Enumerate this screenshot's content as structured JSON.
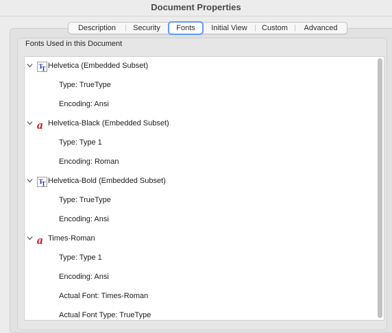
{
  "window": {
    "title": "Document Properties"
  },
  "tabs": [
    {
      "label": "Description",
      "active": false
    },
    {
      "label": "Security",
      "active": false
    },
    {
      "label": "Fonts",
      "active": true
    },
    {
      "label": "Initial View",
      "active": false
    },
    {
      "label": "Custom",
      "active": false
    },
    {
      "label": "Advanced",
      "active": false
    }
  ],
  "fonts_panel": {
    "group_label": "Fonts Used in this Document",
    "fonts": [
      {
        "name": "Helvetica (Embedded Subset)",
        "icon": "truetype-font-icon",
        "expanded": true,
        "details": [
          "Type: TrueType",
          "Encoding: Ansi"
        ]
      },
      {
        "name": "Helvetica-Black (Embedded Subset)",
        "icon": "type1-font-icon",
        "expanded": true,
        "details": [
          "Type: Type 1",
          "Encoding: Roman"
        ]
      },
      {
        "name": "Helvetica-Bold (Embedded Subset)",
        "icon": "truetype-font-icon",
        "expanded": true,
        "details": [
          "Type: TrueType",
          "Encoding: Ansi"
        ]
      },
      {
        "name": "Times-Roman",
        "icon": "type1-font-icon",
        "expanded": true,
        "details": [
          "Type: Type 1",
          "Encoding: Ansi",
          "Actual Font: Times-Roman",
          "Actual Font Type: TrueType"
        ]
      }
    ]
  },
  "colors": {
    "active_tab_ring": "#5b9af7",
    "type1_icon": "#c8181e",
    "truetype_icon": "#1d2fa8"
  }
}
